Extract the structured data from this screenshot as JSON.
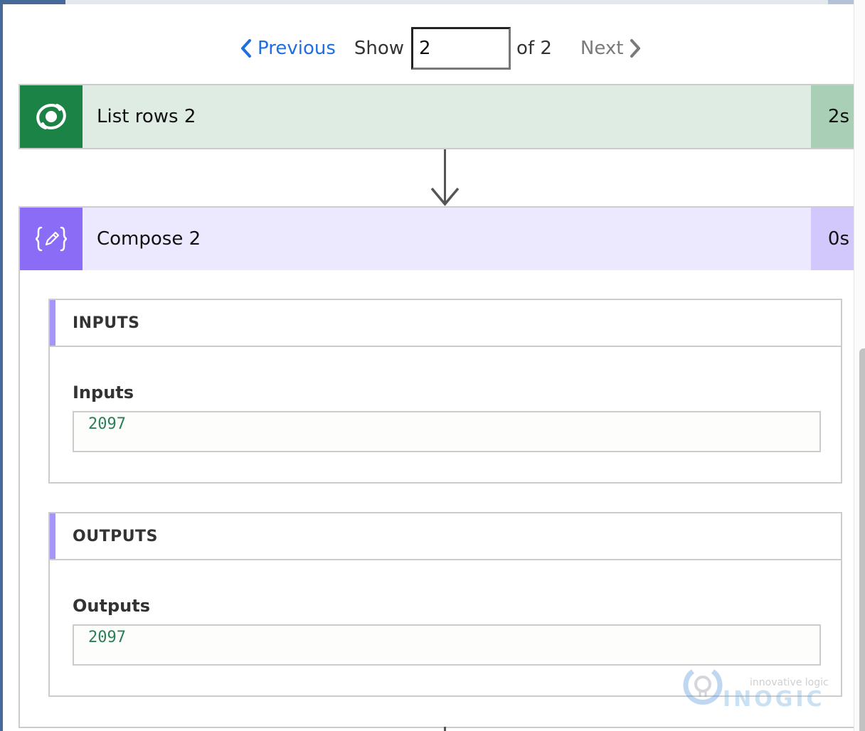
{
  "pager": {
    "previous_label": "Previous",
    "show_label": "Show",
    "current_page": "2",
    "of_label": "of 2",
    "next_label": "Next",
    "previous_color": "#1f6fe0",
    "next_color": "#7a7a7a"
  },
  "actions": [
    {
      "title": "List rows 2",
      "duration": "2s",
      "icon": "dataverse-icon",
      "accent": "#1b8345"
    },
    {
      "title": "Compose 2",
      "duration": "0s",
      "icon": "compose-braces-pencil-icon",
      "accent": "#8b6cf7",
      "inputs": {
        "section_label": "INPUTS",
        "field_label": "Inputs",
        "value": "2097"
      },
      "outputs": {
        "section_label": "OUTPUTS",
        "field_label": "Outputs",
        "value": "2097"
      }
    }
  ],
  "watermark": {
    "tagline": "innovative logic",
    "brand": "INOGIC"
  }
}
